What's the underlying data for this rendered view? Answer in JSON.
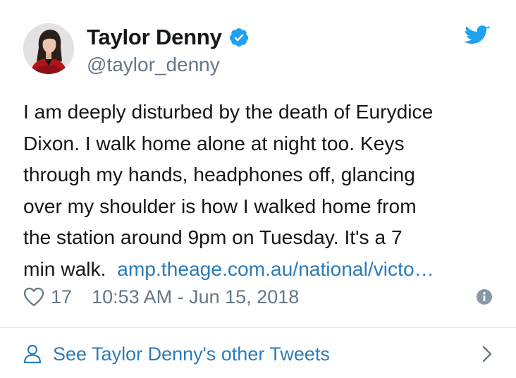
{
  "author": {
    "name": "Taylor Denny",
    "handle": "@taylor_denny",
    "verified": true
  },
  "tweet": {
    "text": "I am deeply disturbed by the death of Eurydice\nDixon. I walk home alone at night too. Keys\nthrough my hands, headphones off, glancing\nover my shoulder is how I walked home from\nthe station around 9pm on Tuesday. It's a 7\nmin walk.  ",
    "link_text": "amp.theage.com.au/national/victo…"
  },
  "meta": {
    "likes": "17",
    "timestamp": "10:53 AM - Jun 15, 2018"
  },
  "footer": {
    "label": "See Taylor Denny's other Tweets"
  },
  "colors": {
    "twitter_blue": "#1da1f2",
    "link_blue": "#2b7bb9",
    "muted_gray": "#657786",
    "divider": "#e1e8ed"
  },
  "icons": {
    "brand": "twitter-bird-icon",
    "verified": "verified-badge-icon",
    "like": "heart-outline-icon",
    "info": "info-circle-icon",
    "profile": "person-outline-icon",
    "more": "chevron-right-icon"
  }
}
